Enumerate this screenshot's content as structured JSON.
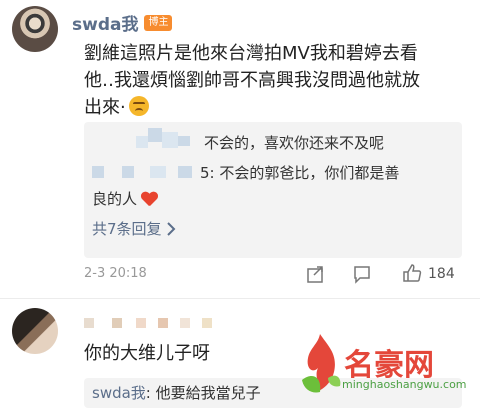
{
  "comment1": {
    "author": "swda我",
    "badge": "博主",
    "text_line1": "劉維這照片是他來台灣拍MV我和碧婷去看",
    "text_line2": "他‥我還煩惱劉帥哥不高興我沒問過他就放",
    "text_line3": "出來·",
    "replies": [
      {
        "text": "不会的，喜欢你还来不及呢"
      },
      {
        "text_part1": "5: 不会的郭爸比，你们都是善",
        "text_part2": "良的人"
      }
    ],
    "more_replies": "共7条回复",
    "timestamp": "2-3 20:18",
    "like_count": "184"
  },
  "comment2": {
    "text": "你的大维儿子呀",
    "reply_author": "swda我",
    "reply_text": ": 他要給我當兒子"
  },
  "watermark": {
    "brand": "名豪网",
    "url": "minghaoshangwu.com"
  },
  "colors": {
    "link": "#5b6e8a",
    "badge": "#f78c2f",
    "heart": "#e8432e",
    "watermark_red": "#e4473a",
    "watermark_green": "#4ca044"
  },
  "icons": [
    "share-icon",
    "comment-icon",
    "like-icon",
    "heart-icon",
    "sad-emoji-icon",
    "chevron-right-icon"
  ]
}
